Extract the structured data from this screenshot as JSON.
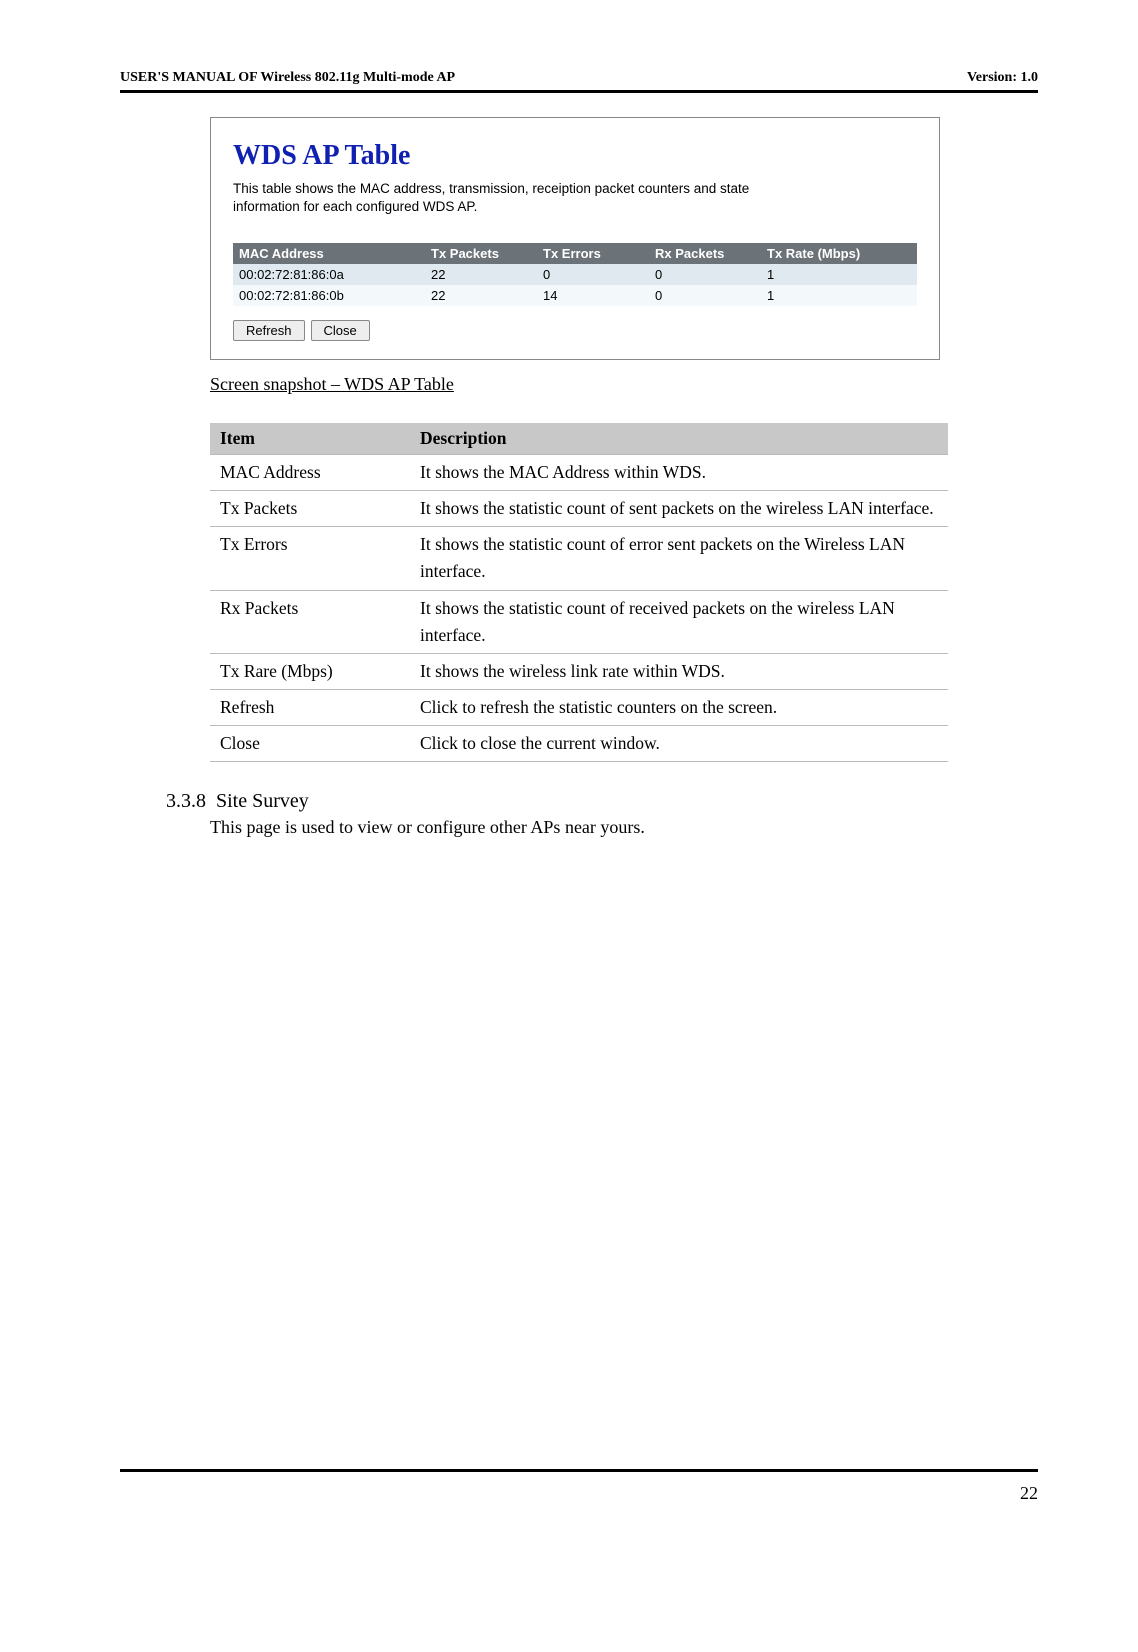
{
  "header": {
    "left": "USER'S MANUAL OF Wireless 802.11g Multi-mode AP",
    "right": "Version: 1.0"
  },
  "screenshot": {
    "title": "WDS AP Table",
    "intro_line1": "This table shows the MAC address, transmission, receiption packet counters and state",
    "intro_line2": "information for each configured WDS AP.",
    "columns": {
      "c0": "MAC Address",
      "c1": "Tx Packets",
      "c2": "Tx Errors",
      "c3": "Rx Packets",
      "c4": "Tx Rate (Mbps)"
    },
    "rows": [
      {
        "mac": "00:02:72:81:86:0a",
        "txp": "22",
        "txe": "0",
        "rxp": "0",
        "rate": "1"
      },
      {
        "mac": "00:02:72:81:86:0b",
        "txp": "22",
        "txe": "14",
        "rxp": "0",
        "rate": "1"
      }
    ],
    "refresh_label": "Refresh",
    "close_label": "Close"
  },
  "caption": "Screen snapshot – WDS AP Table",
  "desc": {
    "head_item": "Item",
    "head_desc": "Description",
    "rows": [
      {
        "item": "MAC Address",
        "desc": "It shows the MAC Address within WDS."
      },
      {
        "item": "Tx Packets",
        "desc": "It shows the statistic count of sent packets on the wireless LAN interface."
      },
      {
        "item": "Tx Errors",
        "desc": "It shows the statistic count of error sent packets on the Wireless LAN interface."
      },
      {
        "item": "Rx Packets",
        "desc": "It shows the statistic count of received packets on the wireless LAN interface."
      },
      {
        "item": "Tx Rare (Mbps)",
        "desc": "It shows the wireless link rate within WDS."
      },
      {
        "item": "Refresh",
        "desc": "Click to refresh the statistic counters on the screen."
      },
      {
        "item": "Close",
        "desc": "Click to close the current window."
      }
    ]
  },
  "section": {
    "number": "3.3.8",
    "title": "Site Survey",
    "body": "This page is used to view or configure other APs near yours."
  },
  "page_number": "22"
}
